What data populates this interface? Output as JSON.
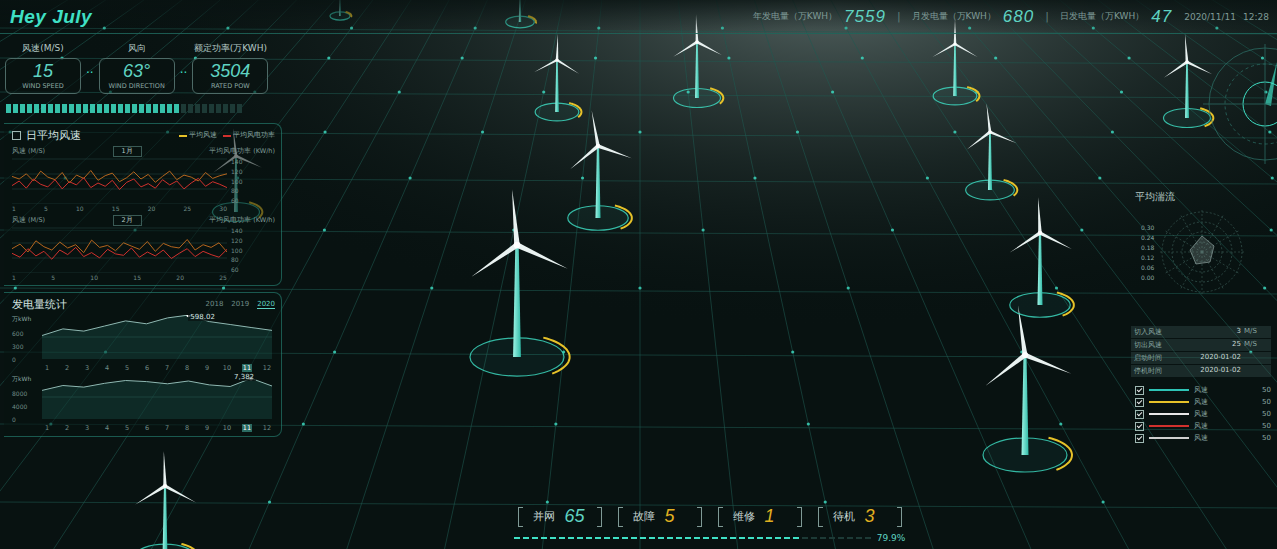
{
  "brand": "Hey July",
  "header": {
    "stats": [
      {
        "label": "年发电量（万KWH）",
        "value": "7559"
      },
      {
        "label": "月发电量（万KWH）",
        "value": "680"
      },
      {
        "label": "日发电量（万KWH）",
        "value": "47"
      }
    ],
    "separator": "|",
    "date": "2020/11/11",
    "time": "12:28"
  },
  "kpis": [
    {
      "label": "风速(M/S)",
      "value": "15",
      "caption": "WIND SPEED"
    },
    {
      "label": "风向",
      "value": "63°",
      "caption": "WIND DIRECTION"
    },
    {
      "label": "额定功率(万KWH)",
      "value": "3504",
      "caption": "RATED POW"
    }
  ],
  "kpi_separator": "··",
  "signal": {
    "level": 0.72
  },
  "wind_panel": {
    "title": "日平均风速",
    "legend": [
      {
        "name": "平均风速",
        "color": "#e6c229"
      },
      {
        "name": "平均风电功率",
        "color": "#d0312d"
      }
    ],
    "charts": [
      {
        "month": "1月",
        "y_label": "风速 (M/S)",
        "y2_label": "平均风电功率 (KW/h)",
        "ticks": [
          "140",
          "120",
          "100",
          "80",
          "60"
        ],
        "x_ticks": [
          "1",
          "5",
          "10",
          "15",
          "20",
          "25",
          "30"
        ],
        "series": [
          {
            "name": "平均风速",
            "color": "#b5651d",
            "values": [
              62,
              58,
              66,
              55,
              70,
              61,
              57,
              68,
              52,
              64,
              59,
              71,
              56,
              63,
              67,
              54,
              60,
              69,
              58,
              65,
              53,
              62,
              70,
              57,
              64,
              61,
              55,
              68,
              59,
              63,
              66
            ]
          },
          {
            "name": "平均风电功率",
            "color": "#d0312d",
            "values": [
              48,
              55,
              44,
              58,
              50,
              46,
              57,
              43,
              54,
              49,
              60,
              45,
              52,
              47,
              56,
              42,
              53,
              58,
              46,
              51,
              44,
              57,
              49,
              55,
              43,
              52,
              59,
              47,
              54,
              50,
              45
            ]
          }
        ]
      },
      {
        "month": "2月",
        "y_label": "风速 (M/S)",
        "y2_label": "平均风电功率 (KW/h)",
        "ticks": [
          "140",
          "120",
          "100",
          "80",
          "60"
        ],
        "x_ticks": [
          "1",
          "5",
          "10",
          "15",
          "20",
          "25"
        ],
        "series": [
          {
            "name": "平均风速",
            "color": "#b5651d",
            "values": [
              57,
              64,
              52,
              69,
              60,
              55,
              67,
              58,
              63,
              51,
              70,
              59,
              62,
              54,
              66,
              61,
              56,
              68,
              53,
              65,
              60,
              58,
              71,
              55,
              63,
              59,
              66,
              52
            ]
          },
          {
            "name": "平均风电功率",
            "color": "#d0312d",
            "values": [
              50,
              44,
              57,
              46,
              53,
              41,
              55,
              48,
              59,
              45,
              51,
              43,
              56,
              49,
              47,
              58,
              44,
              52,
              46,
              55,
              42,
              50,
              57,
              45,
              53,
              48,
              44,
              56
            ]
          }
        ]
      }
    ]
  },
  "power_panel": {
    "title": "发电量统计",
    "years": [
      {
        "label": "2018",
        "selected": false
      },
      {
        "label": "2019",
        "selected": false
      },
      {
        "label": "2020",
        "selected": true
      }
    ],
    "months": [
      {
        "label": "1",
        "selected": false
      },
      {
        "label": "2",
        "selected": false
      },
      {
        "label": "3",
        "selected": false
      },
      {
        "label": "4",
        "selected": false
      },
      {
        "label": "5",
        "selected": false
      },
      {
        "label": "6",
        "selected": false
      },
      {
        "label": "7",
        "selected": false
      },
      {
        "label": "8",
        "selected": false
      },
      {
        "label": "9",
        "selected": false
      },
      {
        "label": "10",
        "selected": false
      },
      {
        "label": "11",
        "selected": true
      },
      {
        "label": "12",
        "selected": false
      }
    ],
    "charts": [
      {
        "unit": "万kWh",
        "ticks": [
          "600",
          "300",
          "0"
        ],
        "max": 600,
        "peak": "598.02",
        "values": [
          320,
          410,
          380,
          450,
          520,
          480,
          560,
          598.02,
          510,
          470,
          430,
          390
        ]
      },
      {
        "unit": "万kWh",
        "ticks": [
          "8000",
          "4000",
          "0"
        ],
        "max": 8000,
        "peak": "7,382",
        "values": [
          5200,
          6100,
          5800,
          6500,
          7000,
          6800,
          6400,
          6900,
          6200,
          5900,
          7382,
          6000
        ]
      }
    ]
  },
  "status_bar": {
    "items": [
      {
        "label": "并网",
        "value": "65",
        "color": "#5fd3c2"
      },
      {
        "label": "故障",
        "value": "5",
        "color": "#e0b020"
      },
      {
        "label": "维修",
        "value": "1",
        "color": "#e0b020"
      },
      {
        "label": "待机",
        "value": "3",
        "color": "#e0b020"
      }
    ],
    "progress": {
      "level": 0.799,
      "reading": "79.9%"
    }
  },
  "turbulence": {
    "title": "平均湍流",
    "ticks": [
      "0.30",
      "0.24",
      "0.18",
      "0.12",
      "0.06",
      "0.00"
    ]
  },
  "params": [
    {
      "label": "切入风速",
      "value": "3",
      "unit": "M/S"
    },
    {
      "label": "切出风速",
      "value": "25",
      "unit": "M/S"
    },
    {
      "label": "启动时间",
      "value": "2020-01-02",
      "unit": ""
    },
    {
      "label": "停机时间",
      "value": "2020-01-02",
      "unit": ""
    }
  ],
  "legend_list": [
    {
      "name": "风速",
      "value": "50",
      "checked": true,
      "color": "#2ec4b6"
    },
    {
      "name": "风速",
      "value": "50",
      "checked": true,
      "color": "#e6c229"
    },
    {
      "name": "风速",
      "value": "50",
      "checked": true,
      "color": "#e8e8e8"
    },
    {
      "name": "风速",
      "value": "50",
      "checked": true,
      "color": "#d0312d"
    },
    {
      "name": "风速",
      "value": "50",
      "checked": true,
      "color": "#cfcfcf"
    }
  ],
  "turbines": [
    {
      "level": 0.3
    },
    {
      "level": 0.3
    },
    {
      "level": 0.25
    },
    {
      "level": 0.25
    },
    {
      "level": 0.3
    },
    {
      "level": 0.3
    },
    {
      "level": 0.25
    },
    {
      "level": 0.25
    },
    {
      "level": 0.3
    },
    {
      "level": 0.2
    },
    {
      "level": 0.2
    },
    {
      "level": 0.25
    },
    {
      "level": 0.2
    }
  ]
}
